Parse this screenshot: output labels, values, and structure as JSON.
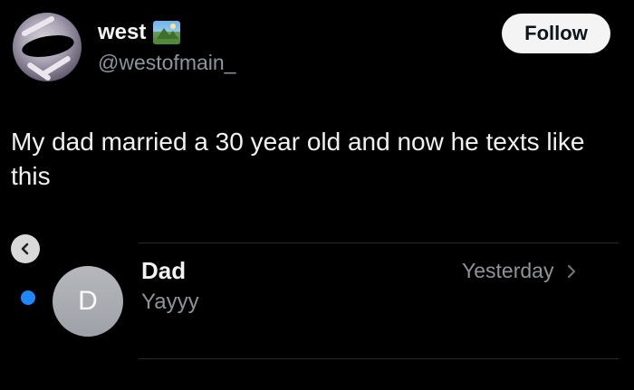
{
  "tweet": {
    "display_name": "west",
    "handle": "@westofmain_",
    "follow_label": "Follow",
    "text": "My dad married a 30 year old and now he texts like this",
    "badge_icon": "landscape-emoji-icon"
  },
  "messages": {
    "back_icon": "chevron-left-icon",
    "contact_name": "Dad",
    "contact_initial": "D",
    "preview": "Yayyy",
    "timestamp": "Yesterday",
    "unread": true,
    "unread_color": "#1d88ff"
  }
}
